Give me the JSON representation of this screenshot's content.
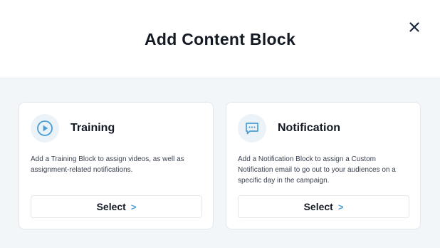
{
  "modal": {
    "title": "Add Content Block",
    "close_icon": "close-icon"
  },
  "cards": [
    {
      "icon": "play-circle-icon",
      "title": "Training",
      "description": "Add a Training Block to assign videos, as well as assignment-related notifications.",
      "select_label": "Select",
      "select_arrow": ">"
    },
    {
      "icon": "chat-bubble-icon",
      "title": "Notification",
      "description": "Add a Notification Block to assign a Custom Notification email to go out to your audiences on a specific day in the campaign.",
      "select_label": "Select",
      "select_arrow": ">"
    }
  ],
  "colors": {
    "accent": "#4a9fd6",
    "icon_bg": "#ecf3f8",
    "body_bg": "#f3f6f9",
    "title_text": "#141a24"
  }
}
